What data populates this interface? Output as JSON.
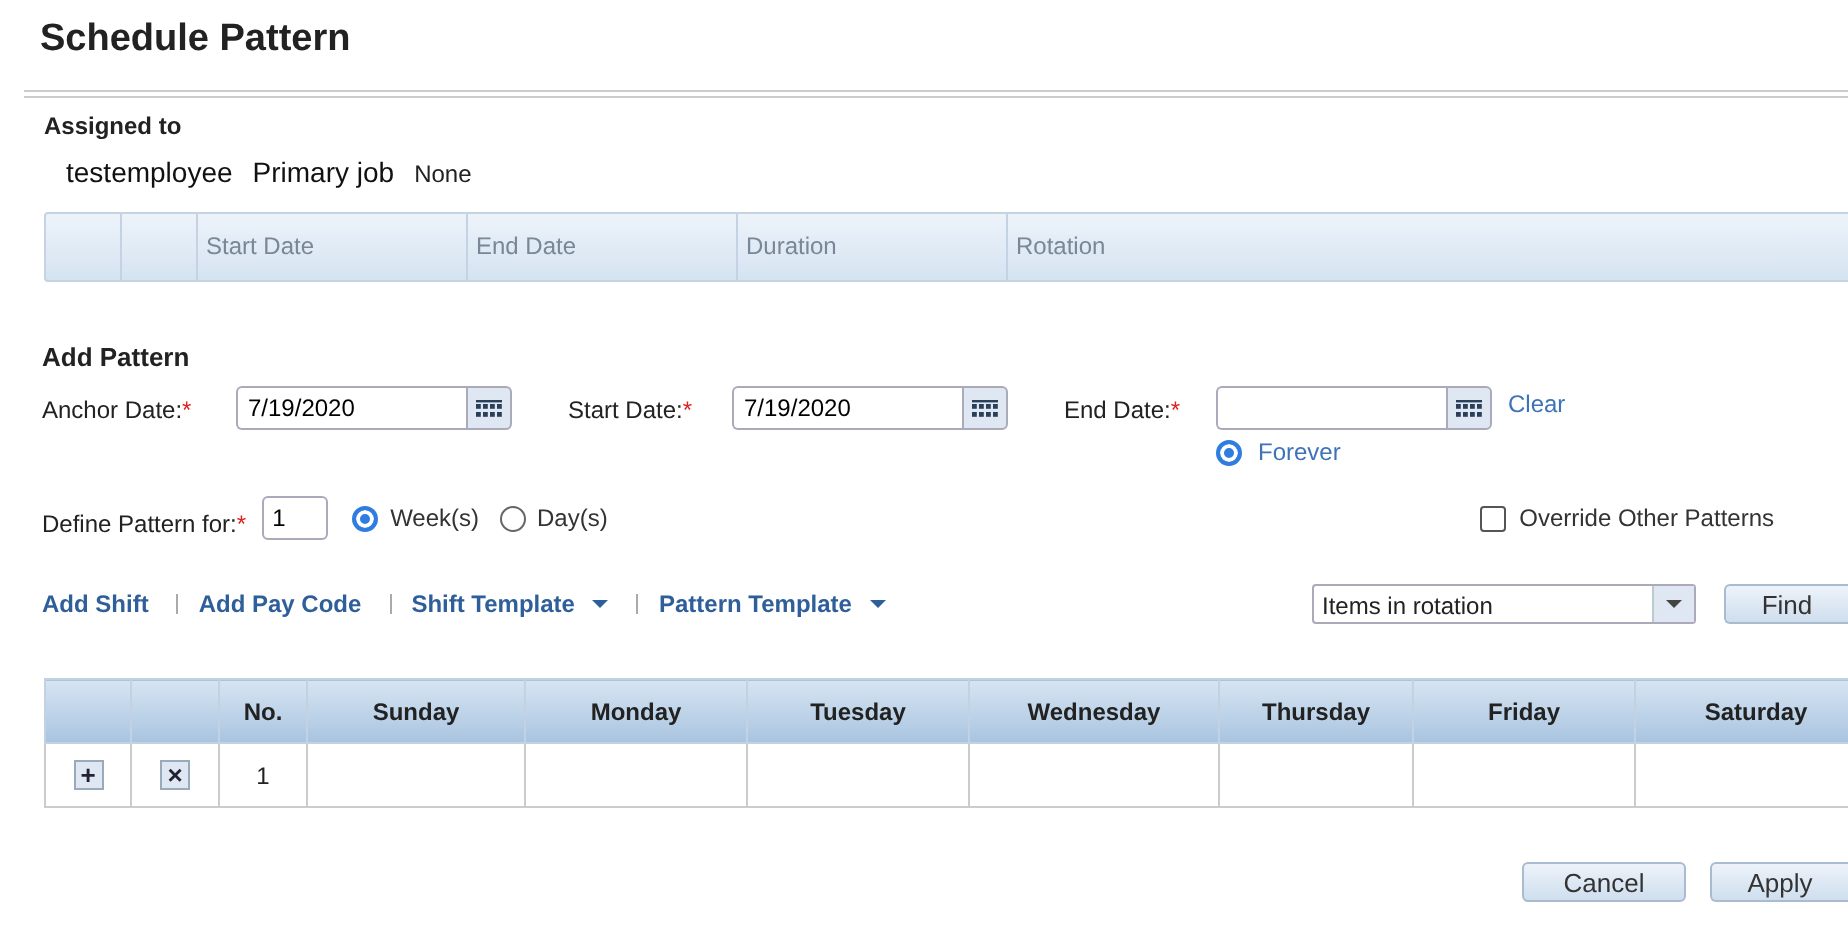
{
  "title": "Schedule Pattern",
  "assigned": {
    "label": "Assigned to",
    "employee": "testemployee",
    "job_label": "Primary job",
    "job_value": "None"
  },
  "history_table": {
    "columns": [
      "",
      "",
      "Start Date",
      "End Date",
      "Duration",
      "Rotation"
    ]
  },
  "add_pattern": {
    "heading": "Add Pattern",
    "dates": [
      {
        "label": "Anchor Date:",
        "required_mark": "*",
        "value": "7/19/2020"
      },
      {
        "label": "Start Date:",
        "required_mark": "*",
        "value": "7/19/2020"
      },
      {
        "label": "End Date:",
        "required_mark": "*"
      }
    ],
    "clear": "Clear",
    "forever": {
      "label": "Forever",
      "selected": true
    },
    "define": {
      "label": "Define Pattern for:",
      "required_mark": "*",
      "value": "1"
    },
    "units": [
      {
        "label": "Week(s)",
        "selected": true
      },
      {
        "label": "Day(s)",
        "selected": false
      }
    ],
    "override": {
      "label": "Override Other Patterns",
      "checked": false
    }
  },
  "actions": [
    {
      "label": "Add Shift",
      "dropdown": false
    },
    {
      "label": "Add Pay Code",
      "dropdown": false
    },
    {
      "label": "Shift Template",
      "dropdown": true
    },
    {
      "label": "Pattern Template",
      "dropdown": true
    }
  ],
  "filter": {
    "value": "Items in rotation"
  },
  "find": "Find",
  "grid": {
    "columns": [
      "",
      "",
      "No.",
      "Sunday",
      "Monday",
      "Tuesday",
      "Wednesday",
      "Thursday",
      "Friday",
      "Saturday"
    ],
    "rows": [
      {
        "add": "+",
        "remove": "×",
        "no": "1"
      }
    ]
  },
  "buttons": [
    "Cancel",
    "Apply"
  ]
}
